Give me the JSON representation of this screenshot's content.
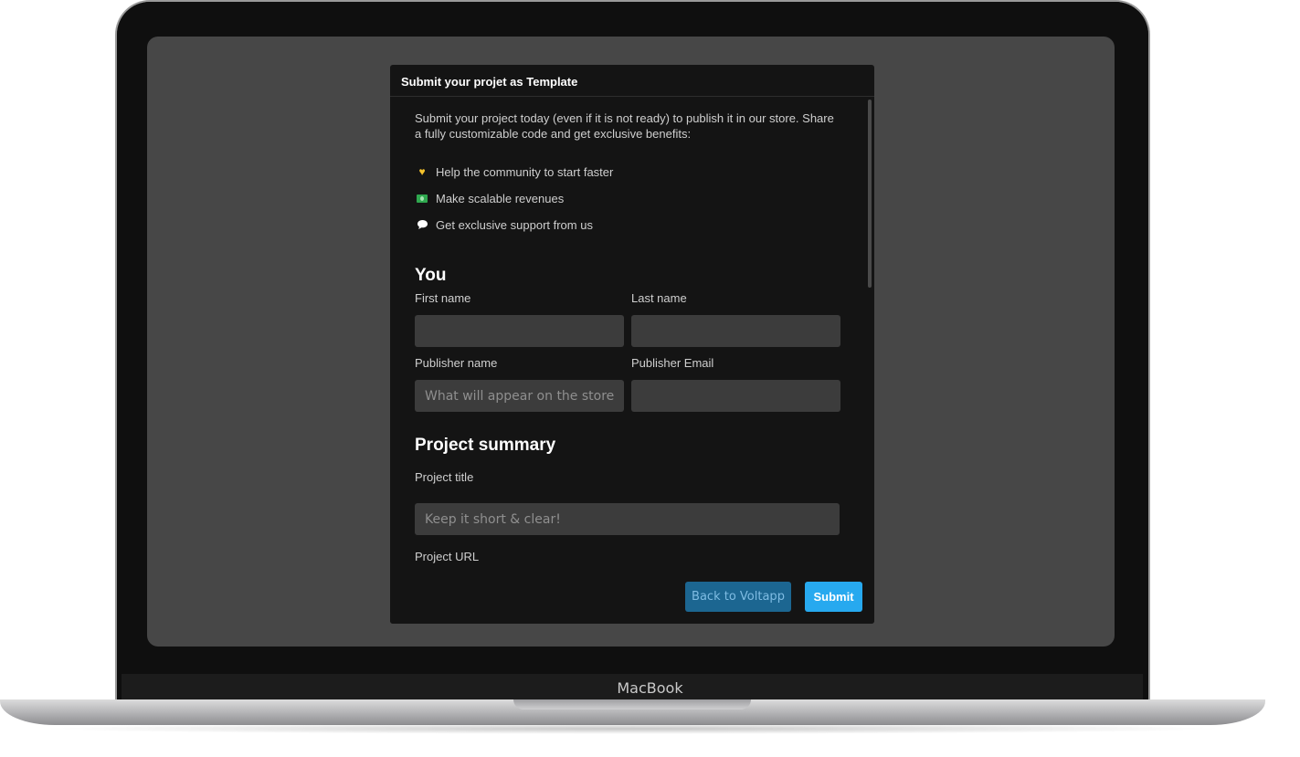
{
  "device": {
    "brand": "MacBook"
  },
  "modal": {
    "title": "Submit your projet as Template",
    "intro": "Submit your project today (even if it is not ready) to publish it in our store. Share a fully customizable code and get exclusive benefits:",
    "benefits": [
      {
        "icon": "heart-hands-icon",
        "label": "Help the community to start faster"
      },
      {
        "icon": "money-icon",
        "label": "Make scalable revenues"
      },
      {
        "icon": "speech-bubble-icon",
        "label": "Get exclusive support from us"
      }
    ],
    "you": {
      "heading": "You",
      "first_name_label": "First name",
      "first_name_value": "",
      "last_name_label": "Last name",
      "last_name_value": "",
      "publisher_name_label": "Publisher name",
      "publisher_name_placeholder": "What will appear on the store",
      "publisher_email_label": "Publisher Email",
      "publisher_email_value": ""
    },
    "summary": {
      "heading": "Project summary",
      "title_label": "Project title",
      "title_placeholder": "Keep it short & clear!",
      "url_label": "Project URL"
    },
    "footer": {
      "back_label": "Back to Voltapp",
      "submit_label": "Submit"
    }
  },
  "colors": {
    "screen_bg": "#474747",
    "modal_bg": "#141414",
    "input_bg": "#3c3c3c",
    "primary": "#27a9ef",
    "secondary": "#1c6691"
  }
}
